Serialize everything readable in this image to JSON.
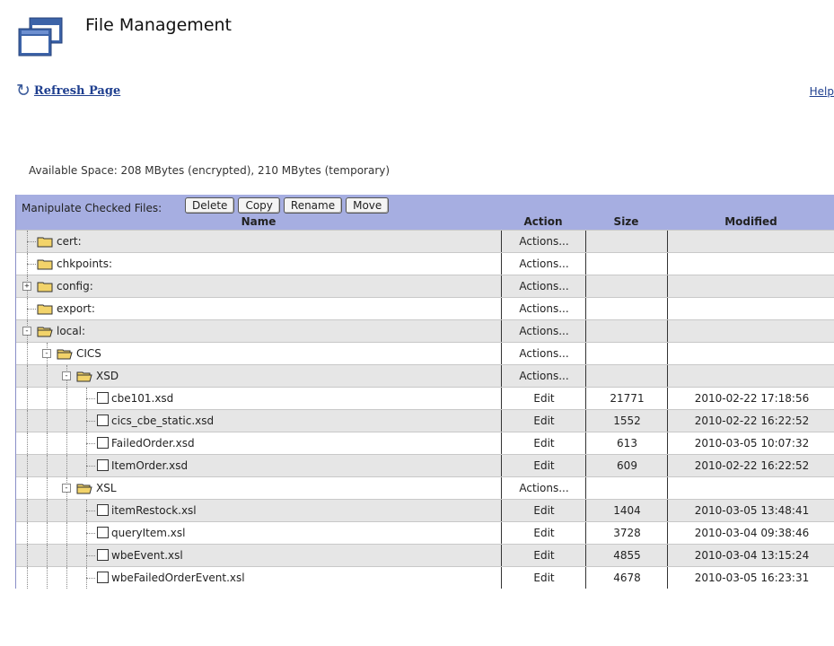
{
  "header": {
    "title": "File Management",
    "refresh_label": "Refresh Page",
    "help_label": "Help"
  },
  "space_info": "Available Space: 208 MBytes (encrypted), 210 MBytes (temporary)",
  "toolbar": {
    "label": "Manipulate Checked Files:",
    "buttons": [
      "Delete",
      "Copy",
      "Rename",
      "Move"
    ]
  },
  "columns": {
    "name": "Name",
    "action": "Action",
    "size": "Size",
    "modified": "Modified"
  },
  "rows": [
    {
      "name": "cert:",
      "kind": "folder",
      "depth": 0,
      "expander": "",
      "action": "Actions...",
      "size": "",
      "modified": ""
    },
    {
      "name": "chkpoints:",
      "kind": "folder",
      "depth": 0,
      "expander": "",
      "action": "Actions...",
      "size": "",
      "modified": ""
    },
    {
      "name": "config:",
      "kind": "folder",
      "depth": 0,
      "expander": "+",
      "action": "Actions...",
      "size": "",
      "modified": ""
    },
    {
      "name": "export:",
      "kind": "folder",
      "depth": 0,
      "expander": "",
      "action": "Actions...",
      "size": "",
      "modified": ""
    },
    {
      "name": "local:",
      "kind": "open-folder",
      "depth": 0,
      "expander": "-",
      "action": "Actions...",
      "size": "",
      "modified": ""
    },
    {
      "name": "CICS",
      "kind": "open-folder",
      "depth": 1,
      "expander": "-",
      "action": "Actions...",
      "size": "",
      "modified": ""
    },
    {
      "name": "XSD",
      "kind": "open-folder",
      "depth": 2,
      "expander": "-",
      "action": "Actions...",
      "size": "",
      "modified": ""
    },
    {
      "name": "cbe101.xsd",
      "kind": "file",
      "depth": 3,
      "expander": "",
      "action": "Edit",
      "size": "21771",
      "modified": "2010-02-22 17:18:56"
    },
    {
      "name": "cics_cbe_static.xsd",
      "kind": "file",
      "depth": 3,
      "expander": "",
      "action": "Edit",
      "size": "1552",
      "modified": "2010-02-22 16:22:52"
    },
    {
      "name": "FailedOrder.xsd",
      "kind": "file",
      "depth": 3,
      "expander": "",
      "action": "Edit",
      "size": "613",
      "modified": "2010-03-05 10:07:32"
    },
    {
      "name": "ItemOrder.xsd",
      "kind": "file",
      "depth": 3,
      "expander": "",
      "action": "Edit",
      "size": "609",
      "modified": "2010-02-22 16:22:52"
    },
    {
      "name": "XSL",
      "kind": "open-folder",
      "depth": 2,
      "expander": "-",
      "action": "Actions...",
      "size": "",
      "modified": ""
    },
    {
      "name": "itemRestock.xsl",
      "kind": "file",
      "depth": 3,
      "expander": "",
      "action": "Edit",
      "size": "1404",
      "modified": "2010-03-05 13:48:41"
    },
    {
      "name": "queryItem.xsl",
      "kind": "file",
      "depth": 3,
      "expander": "",
      "action": "Edit",
      "size": "3728",
      "modified": "2010-03-04 09:38:46"
    },
    {
      "name": "wbeEvent.xsl",
      "kind": "file",
      "depth": 3,
      "expander": "",
      "action": "Edit",
      "size": "4855",
      "modified": "2010-03-04 13:15:24"
    },
    {
      "name": "wbeFailedOrderEvent.xsl",
      "kind": "file",
      "depth": 3,
      "expander": "",
      "action": "Edit",
      "size": "4678",
      "modified": "2010-03-05 16:23:31"
    }
  ],
  "colors": {
    "header_bg": "#a6aee1",
    "row_alt": "#e6e6e6",
    "link": "#1f3f8f",
    "folder": "#f2d36a"
  }
}
